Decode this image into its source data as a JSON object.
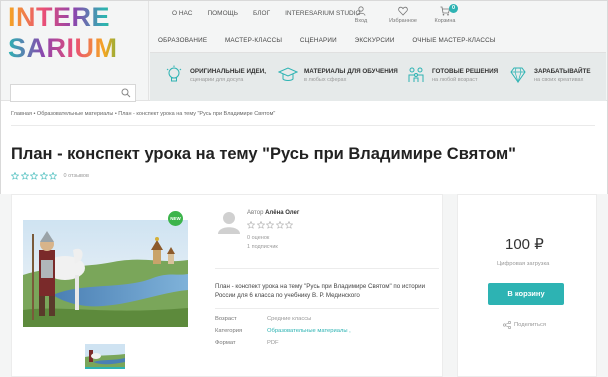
{
  "header": {
    "logo": {
      "line1": "INTERE",
      "line2": "SARIUM"
    },
    "top_nav": [
      "О НАС",
      "ПОМОЩЬ",
      "БЛОГ",
      "INTERESARIUM STUDIO"
    ],
    "icons": [
      {
        "name": "user-icon",
        "label": "Вход"
      },
      {
        "name": "heart-icon",
        "label": "Избранное"
      },
      {
        "name": "cart-icon",
        "label": "Корзина",
        "badge": "0"
      }
    ],
    "category_nav": [
      "ОБРАЗОВАНИЕ",
      "МАСТЕР-КЛАССЫ",
      "СЦЕНАРИИ",
      "ЭКСКУРСИИ",
      "ОЧНЫЕ МАСТЕР-КЛАССЫ"
    ],
    "search": {
      "value": ""
    },
    "features": [
      {
        "icon": "lightbulb-icon",
        "title": "ОРИГИНАЛЬНЫЕ ИДЕИ,",
        "subtitle": "сценарии для досуга"
      },
      {
        "icon": "graduation-cap-icon",
        "title": "МАТЕРИАЛЫ ДЛЯ ОБУЧЕНИЯ",
        "subtitle": "в любых сферах"
      },
      {
        "icon": "family-icon",
        "title": "ГОТОВЫЕ РЕШЕНИЯ",
        "subtitle": "на любой возраст"
      },
      {
        "icon": "diamond-icon",
        "title": "ЗАРАБАТЫВАЙТЕ",
        "subtitle": "на своих креативах"
      }
    ]
  },
  "breadcrumb": "Главная • Образовательные материалы • План - конспект урока на тему \"Русь при Владимире Святом\"",
  "page": {
    "title": "План - конспект урока на тему \"Русь при Владимире Святом\"",
    "reviews": "0 отзывов"
  },
  "product": {
    "badge": "NEW",
    "author_prefix": "Автор",
    "author_name": "Алёна Олег",
    "author_rating": "0 оценок",
    "author_subscribers": "1 подписчик",
    "description": "План - конспект урока на тему \"Русь при Владимире Святом\" по истории России для 6 класса по учебнику В. Р. Мединского",
    "props": [
      {
        "key": "Возраст",
        "value": "Средние классы"
      },
      {
        "key": "Категория",
        "value": "Образовательные материалы ,"
      },
      {
        "key": "Формат",
        "value": "PDF"
      }
    ]
  },
  "purchase": {
    "price": "100 ₽",
    "type": "Цифровая загрузка",
    "button": "В корзину",
    "share": "Поделиться"
  },
  "colors": {
    "accent": "#2db3b3",
    "new_badge": "#3cb44b"
  }
}
